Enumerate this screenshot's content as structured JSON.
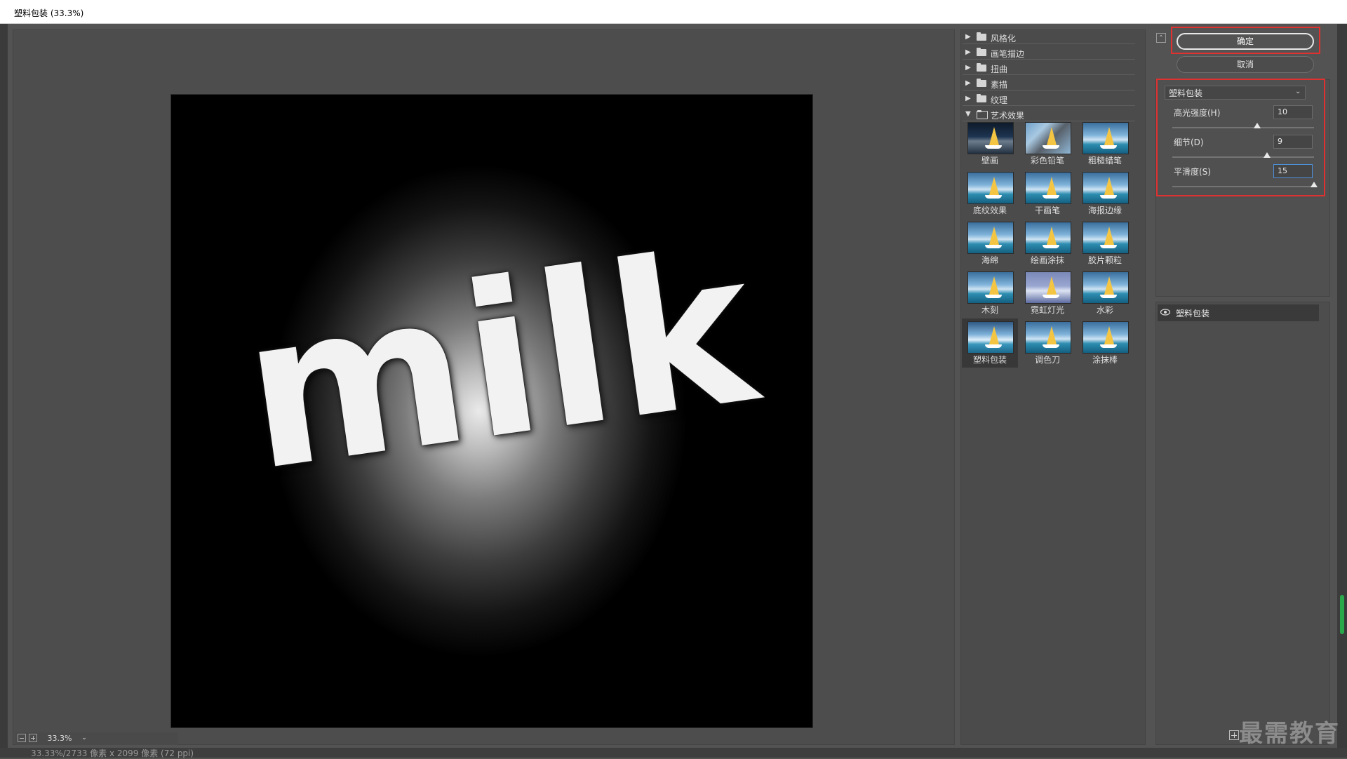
{
  "window": {
    "title": "塑料包装 (33.3%)"
  },
  "preview": {
    "canvas_text": "milk",
    "zoom": "33.3%",
    "zoom_dropdown": "⌄",
    "status_text": "33.33%/2733 像素 x 2099 像素 (72 ppi)"
  },
  "gallery": {
    "categories": [
      {
        "label": "风格化",
        "expanded": false
      },
      {
        "label": "画笔描边",
        "expanded": false
      },
      {
        "label": "扭曲",
        "expanded": false
      },
      {
        "label": "素描",
        "expanded": false
      },
      {
        "label": "纹理",
        "expanded": false
      },
      {
        "label": "艺术效果",
        "expanded": true
      }
    ],
    "filters": [
      {
        "label": "壁画"
      },
      {
        "label": "彩色铅笔"
      },
      {
        "label": "粗糙蜡笔"
      },
      {
        "label": "底纹效果"
      },
      {
        "label": "干画笔"
      },
      {
        "label": "海报边缘"
      },
      {
        "label": "海绵"
      },
      {
        "label": "绘画涂抹"
      },
      {
        "label": "胶片颗粒"
      },
      {
        "label": "木刻"
      },
      {
        "label": "霓虹灯光"
      },
      {
        "label": "水彩"
      },
      {
        "label": "塑料包装",
        "selected": true
      },
      {
        "label": "调色刀"
      },
      {
        "label": "涂抹棒"
      }
    ],
    "expand_glyph": "▶",
    "collapse_glyph": "▼"
  },
  "settings": {
    "ok_label": "确定",
    "cancel_label": "取消",
    "collapse_glyph": "⌃",
    "filter_select": "塑料包装",
    "select_arrow": "⌄",
    "params": [
      {
        "label": "高光强度(H)",
        "value": "10",
        "fraction": 0.6
      },
      {
        "label": "细节(D)",
        "value": "9",
        "fraction": 0.667
      },
      {
        "label": "平滑度(S)",
        "value": "15",
        "fraction": 1.0
      }
    ]
  },
  "layers": {
    "items": [
      {
        "label": "塑料包装"
      }
    ]
  },
  "watermark": "最需教育",
  "colors": {
    "highlight": "#e03131",
    "accent_focus": "#4d8fd6"
  }
}
